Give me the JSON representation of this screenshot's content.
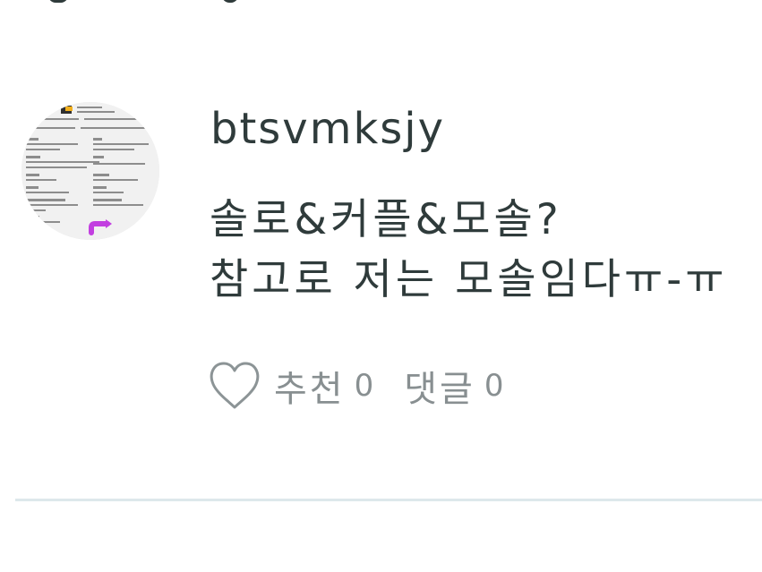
{
  "post": {
    "username": "btsvmksjy",
    "content_lines": [
      "솔로&커플&모솔?",
      "참고로 저는 모솔임다ㅠ-ㅠ"
    ],
    "actions": {
      "like_icon": "heart-outline-icon",
      "recommend_label": "추천",
      "recommend_count": "0",
      "comment_label": "댓글",
      "comment_count": "0"
    }
  },
  "colors": {
    "text": "#2f3b3b",
    "muted": "#888f91",
    "divider": "#dde8eb",
    "background": "#ffffff"
  }
}
